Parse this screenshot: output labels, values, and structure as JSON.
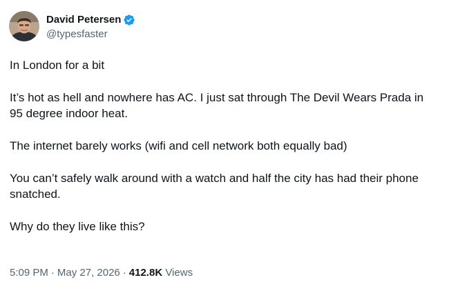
{
  "author": {
    "display_name": "David Petersen",
    "handle": "@typesfaster",
    "verified": true,
    "verified_color": "#1d9bf0"
  },
  "tweet": {
    "paragraphs": [
      "In London for a bit",
      "It’s hot as hell and nowhere has AC. I just sat through The Devil Wears Prada in 95 degree indoor heat.",
      "The internet barely works (wifi and cell network both equally bad)",
      "You can’t safely walk around with a watch and half the city has had their phone snatched.",
      "Why do they live like this?"
    ]
  },
  "meta": {
    "time": "5:09 PM",
    "separator": "·",
    "date": "May 27, 2026",
    "views_count": "412.8K",
    "views_label": "Views"
  },
  "icons": {
    "avatar": "avatar-photo",
    "verified": "verified-badge-icon"
  }
}
